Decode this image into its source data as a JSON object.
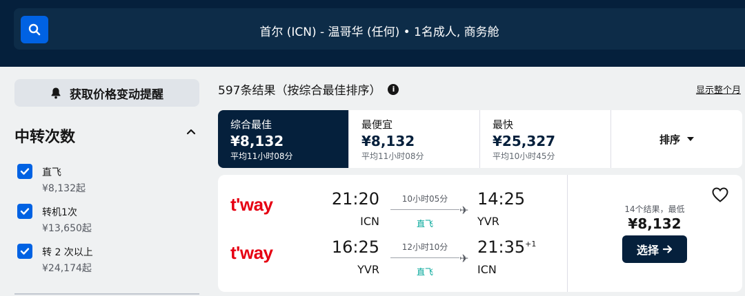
{
  "header": {
    "search_summary": "首尔 (ICN) - 温哥华 (任何)  •  1名成人, 商务舱",
    "search_icon": "search-icon"
  },
  "sidebar": {
    "price_alert_label": "获取价格变动提醒",
    "stops_title": "中转次数",
    "filters": [
      {
        "label": "直飞",
        "price": "¥8,132起",
        "checked": true
      },
      {
        "label": "转机1次",
        "price": "¥13,650起",
        "checked": true
      },
      {
        "label": "转 2 次以上",
        "price": "¥24,174起",
        "checked": true
      }
    ]
  },
  "results": {
    "count_text": "597条结果（按综合最佳排序）",
    "show_month": "显示整个月"
  },
  "sort_tabs": [
    {
      "label": "综合最佳",
      "price": "¥8,132",
      "duration": "平均11小时08分",
      "active": true
    },
    {
      "label": "最便宜",
      "price": "¥8,132",
      "duration": "平均11小时08分",
      "active": false
    },
    {
      "label": "最快",
      "price": "¥25,327",
      "duration": "平均10小时45分",
      "active": false
    }
  ],
  "sort_button": "排序",
  "card": {
    "legs": [
      {
        "airline": "t'way",
        "dep_time": "21:20",
        "dep_code": "ICN",
        "duration": "10小时05分",
        "stops": "直飞",
        "arr_time": "14:25",
        "arr_code": "YVR",
        "arr_offset": ""
      },
      {
        "airline": "t'way",
        "dep_time": "16:25",
        "dep_code": "YVR",
        "duration": "12小时10分",
        "stops": "直飞",
        "arr_time": "21:35",
        "arr_code": "ICN",
        "arr_offset": "+1"
      }
    ],
    "result_count": "14个结果，最低",
    "price": "¥8,132",
    "select_label": "选择"
  },
  "colors": {
    "header_bg": "#05203c",
    "accent": "#0062e3",
    "direct": "#00a698",
    "airline_red": "#e60012"
  }
}
